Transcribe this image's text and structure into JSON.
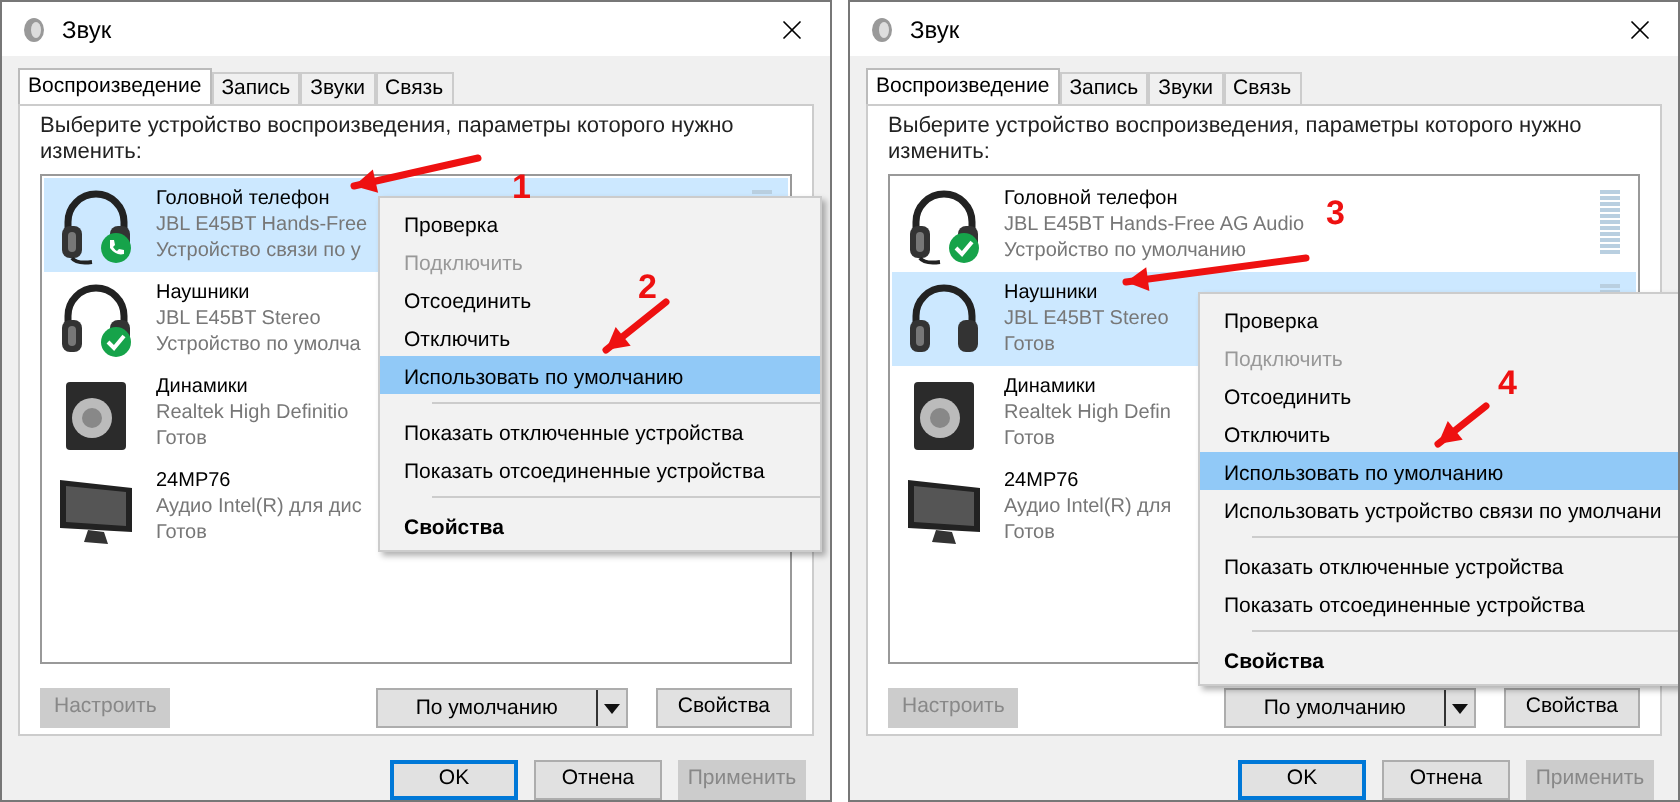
{
  "dialogs": [
    {
      "title": "Звук",
      "tabs": [
        {
          "label": "Воспроизведение",
          "selected": true
        },
        {
          "label": "Запись",
          "selected": false
        },
        {
          "label": "Звуки",
          "selected": false
        },
        {
          "label": "Связь",
          "selected": false
        }
      ],
      "description": "Выберите устройство воспроизведения, параметры которого нужно изменить:",
      "devices": [
        {
          "kind": "headset",
          "default_device": false,
          "default_communication": true,
          "selected": true,
          "name": "Головной телефон",
          "driver": "JBL E45BT Hands-Free",
          "status": "Устройство связи по у"
        },
        {
          "kind": "headphones",
          "default_device": true,
          "default_communication": false,
          "selected": false,
          "name": "Наушники",
          "driver": "JBL E45BT Stereo",
          "status": "Устройство по умолча"
        },
        {
          "kind": "speaker",
          "default_device": false,
          "default_communication": false,
          "selected": false,
          "name": "Динамики",
          "driver": "Realtek High Definitio",
          "status": "Готов"
        },
        {
          "kind": "monitor",
          "default_device": false,
          "default_communication": false,
          "selected": false,
          "name": "24MP76",
          "driver": "Аудио Intel(R) для дис",
          "status": "Готов"
        }
      ],
      "menu": [
        {
          "kind": "item",
          "label": "Проверка",
          "disabled": false,
          "highlighted": false,
          "bold": false
        },
        {
          "kind": "item",
          "label": "Подключить",
          "disabled": true,
          "highlighted": false,
          "bold": false
        },
        {
          "kind": "item",
          "label": "Отсоединить",
          "disabled": false,
          "highlighted": false,
          "bold": false
        },
        {
          "kind": "item",
          "label": "Отключить",
          "disabled": false,
          "highlighted": false,
          "bold": false
        },
        {
          "kind": "item",
          "label": "Использовать по умолчанию",
          "disabled": false,
          "highlighted": true,
          "bold": false
        },
        {
          "kind": "separator"
        },
        {
          "kind": "item",
          "label": "Показать отключенные устройства",
          "disabled": false,
          "highlighted": false,
          "bold": false
        },
        {
          "kind": "item",
          "label": "Показать отсоединенные устройства",
          "disabled": false,
          "highlighted": false,
          "bold": false
        },
        {
          "kind": "separator"
        },
        {
          "kind": "item",
          "label": "Свойства",
          "disabled": false,
          "highlighted": false,
          "bold": true
        }
      ],
      "configure": {
        "label": "Настроить",
        "disabled": true
      },
      "set_default": {
        "label": "По умолчанию"
      },
      "properties": {
        "label": "Свойства"
      },
      "footer": [
        {
          "label": "OK",
          "disabled": false,
          "focused": true
        },
        {
          "label": "Отнена",
          "disabled": false,
          "focused": false
        },
        {
          "label": "Применить",
          "disabled": true,
          "focused": false
        }
      ],
      "markers": [
        {
          "label": "1"
        },
        {
          "label": "2"
        }
      ]
    },
    {
      "title": "Звук",
      "tabs": [
        {
          "label": "Воспроизведение",
          "selected": true
        },
        {
          "label": "Запись",
          "selected": false
        },
        {
          "label": "Звуки",
          "selected": false
        },
        {
          "label": "Связь",
          "selected": false
        }
      ],
      "description": "Выберите устройство воспроизведения, параметры которого нужно изменить:",
      "devices": [
        {
          "kind": "headset",
          "default_device": true,
          "default_communication": false,
          "selected": false,
          "name": "Головной телефон",
          "driver": "JBL E45BT Hands-Free AG Audio",
          "status": "Устройство по умолчанию"
        },
        {
          "kind": "headphones",
          "default_device": false,
          "default_communication": false,
          "selected": true,
          "name": "Наушники",
          "driver": "JBL E45BT Stereo",
          "status": "Готов"
        },
        {
          "kind": "speaker",
          "default_device": false,
          "default_communication": false,
          "selected": false,
          "name": "Динамики",
          "driver": "Realtek High Defin",
          "status": "Готов"
        },
        {
          "kind": "monitor",
          "default_device": false,
          "default_communication": false,
          "selected": false,
          "name": "24MP76",
          "driver": "Аудио Intel(R) для",
          "status": "Готов"
        }
      ],
      "menu": [
        {
          "kind": "item",
          "label": "Проверка",
          "disabled": false,
          "highlighted": false,
          "bold": false
        },
        {
          "kind": "item",
          "label": "Подключить",
          "disabled": true,
          "highlighted": false,
          "bold": false
        },
        {
          "kind": "item",
          "label": "Отсоединить",
          "disabled": false,
          "highlighted": false,
          "bold": false
        },
        {
          "kind": "item",
          "label": "Отключить",
          "disabled": false,
          "highlighted": false,
          "bold": false
        },
        {
          "kind": "item",
          "label": "Использовать по умолчанию",
          "disabled": false,
          "highlighted": true,
          "bold": false
        },
        {
          "kind": "item",
          "label": "Использовать устройство связи по умолчани",
          "disabled": false,
          "highlighted": false,
          "bold": false
        },
        {
          "kind": "separator"
        },
        {
          "kind": "item",
          "label": "Показать отключенные устройства",
          "disabled": false,
          "highlighted": false,
          "bold": false
        },
        {
          "kind": "item",
          "label": "Показать отсоединенные устройства",
          "disabled": false,
          "highlighted": false,
          "bold": false
        },
        {
          "kind": "separator"
        },
        {
          "kind": "item",
          "label": "Свойства",
          "disabled": false,
          "highlighted": false,
          "bold": true
        }
      ],
      "configure": {
        "label": "Настроить",
        "disabled": true
      },
      "set_default": {
        "label": "По умолчанию"
      },
      "properties": {
        "label": "Свойства"
      },
      "footer": [
        {
          "label": "OK",
          "disabled": false,
          "focused": true
        },
        {
          "label": "Отнена",
          "disabled": false,
          "focused": false
        },
        {
          "label": "Применить",
          "disabled": true,
          "focused": false
        }
      ],
      "markers": [
        {
          "label": "3"
        },
        {
          "label": "4"
        }
      ]
    }
  ]
}
